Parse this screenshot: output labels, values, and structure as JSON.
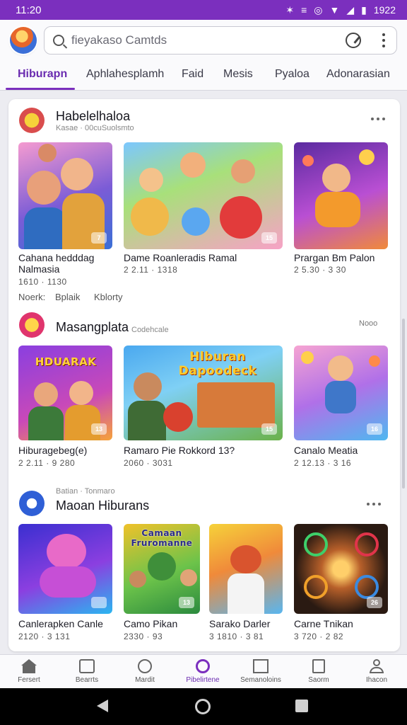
{
  "status_bar": {
    "time": "11:20",
    "icons": [
      "bluetooth-icon",
      "vibrate-icon",
      "alarm-icon",
      "wifi-icon",
      "signal-icon",
      "battery-icon"
    ],
    "battery_text": "1922"
  },
  "search": {
    "placeholder": "fieyakaso Camtds"
  },
  "tabs": [
    {
      "label": "Hiburapn",
      "active": true
    },
    {
      "label": "Aphlahesplamh"
    },
    {
      "label": "Faid"
    },
    {
      "label": "Mesis"
    },
    {
      "label": "Pyaloa"
    },
    {
      "label": "Adonarasian"
    }
  ],
  "sections": [
    {
      "title": "Habelelhaloa",
      "subtitle": "Kasae · 00cuSuolsmto",
      "games": [
        {
          "name": "Cahana hedddag",
          "name2": "Nalmasia",
          "meta": "1610 · 1130",
          "badge": "7"
        },
        {
          "name": "Dame Roanleradis Ramal",
          "meta": "2 2.11 · 1318",
          "badge": "15"
        },
        {
          "name": "Prargan Bm Palon",
          "meta": "2 5.30 · 3 30",
          "badge": ""
        }
      ],
      "chips": [
        "Noerk:",
        "Bplaik",
        "Kblorty"
      ]
    },
    {
      "title": "Masangplata",
      "subtitle": "Codehcale",
      "more_text": "Nooo",
      "games": [
        {
          "name": "Hiburagebeg(e)",
          "meta": "2 2.11 · 9 280",
          "badge": "13",
          "banner": "HDUARAK"
        },
        {
          "name": "Ramaro Pie Rokkord 13?",
          "meta": "2060 · 3031",
          "badge": "15",
          "banner": "Hlburan Dapoodeck"
        },
        {
          "name": "Canalo Meatia",
          "meta": "2 12.13 · 3 16",
          "badge": "16"
        }
      ]
    },
    {
      "title": "Maoan Hiburans",
      "subtitle": "Batian · Tonmaro",
      "games": [
        {
          "name": "Canlerapken Canle",
          "meta": "2120 · 3 131",
          "badge": ""
        },
        {
          "name": "Camo Pikan",
          "meta": "2330 · 93",
          "badge": "13",
          "banner": "Camaan Fruromanne"
        },
        {
          "name": "Sarako Darler",
          "meta": "3 1810 · 3 81",
          "badge": ""
        },
        {
          "name": "Carne Tnikan",
          "meta": "3 720 · 2 82",
          "badge": "26"
        }
      ]
    }
  ],
  "bottom_nav": [
    {
      "label": "Fersert",
      "icon": "home-icon"
    },
    {
      "label": "Bearrts",
      "icon": "list-icon"
    },
    {
      "label": "Mardit",
      "icon": "search-icon"
    },
    {
      "label": "Pibelirtene",
      "icon": "discover-icon",
      "active": true
    },
    {
      "label": "Semanoloins",
      "icon": "mail-icon"
    },
    {
      "label": "Saorm",
      "icon": "doc-icon"
    },
    {
      "label": "Ihacon",
      "icon": "profile-icon"
    }
  ],
  "colors": {
    "accent": "#7b2fbe",
    "status_bar": "#7b2fbe"
  }
}
